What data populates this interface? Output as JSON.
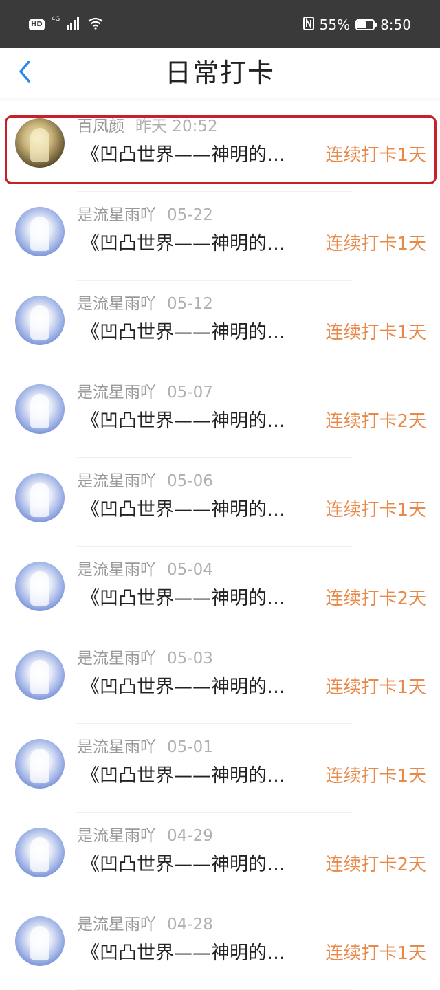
{
  "status_bar": {
    "hd": "HD",
    "network": "4G",
    "battery_percent": "55%",
    "battery_level": 0.55,
    "time": "8:50"
  },
  "header": {
    "title": "日常打卡"
  },
  "items": [
    {
      "name": "百凤颜",
      "date": "昨天 20:52",
      "content": "《凹凸世界——神明的…",
      "streak": "连续打卡1天",
      "avatar": "warm",
      "highlighted": true
    },
    {
      "name": "是流星雨吖",
      "date": "05-22",
      "content": "《凹凸世界——神明的…",
      "streak": "连续打卡1天",
      "avatar": "cool",
      "highlighted": false
    },
    {
      "name": "是流星雨吖",
      "date": "05-12",
      "content": "《凹凸世界——神明的…",
      "streak": "连续打卡1天",
      "avatar": "cool",
      "highlighted": false
    },
    {
      "name": "是流星雨吖",
      "date": "05-07",
      "content": "《凹凸世界——神明的…",
      "streak": "连续打卡2天",
      "avatar": "cool",
      "highlighted": false
    },
    {
      "name": "是流星雨吖",
      "date": "05-06",
      "content": "《凹凸世界——神明的…",
      "streak": "连续打卡1天",
      "avatar": "cool",
      "highlighted": false
    },
    {
      "name": "是流星雨吖",
      "date": "05-04",
      "content": "《凹凸世界——神明的…",
      "streak": "连续打卡2天",
      "avatar": "cool",
      "highlighted": false
    },
    {
      "name": "是流星雨吖",
      "date": "05-03",
      "content": "《凹凸世界——神明的…",
      "streak": "连续打卡1天",
      "avatar": "cool",
      "highlighted": false
    },
    {
      "name": "是流星雨吖",
      "date": "05-01",
      "content": "《凹凸世界——神明的…",
      "streak": "连续打卡1天",
      "avatar": "cool",
      "highlighted": false
    },
    {
      "name": "是流星雨吖",
      "date": "04-29",
      "content": "《凹凸世界——神明的…",
      "streak": "连续打卡2天",
      "avatar": "cool",
      "highlighted": false
    },
    {
      "name": "是流星雨吖",
      "date": "04-28",
      "content": "《凹凸世界——神明的…",
      "streak": "连续打卡1天",
      "avatar": "cool",
      "highlighted": false
    }
  ],
  "colors": {
    "status_bar_bg": "#3a3a3a",
    "back_arrow": "#2a8ee8",
    "streak_text": "#e8894a",
    "highlight_box": "#c8202a"
  },
  "icons": {
    "back": "chevron-left-icon",
    "signal": "signal-icon",
    "wifi": "wifi-icon",
    "nfc": "nfc-icon",
    "battery": "battery-icon"
  }
}
